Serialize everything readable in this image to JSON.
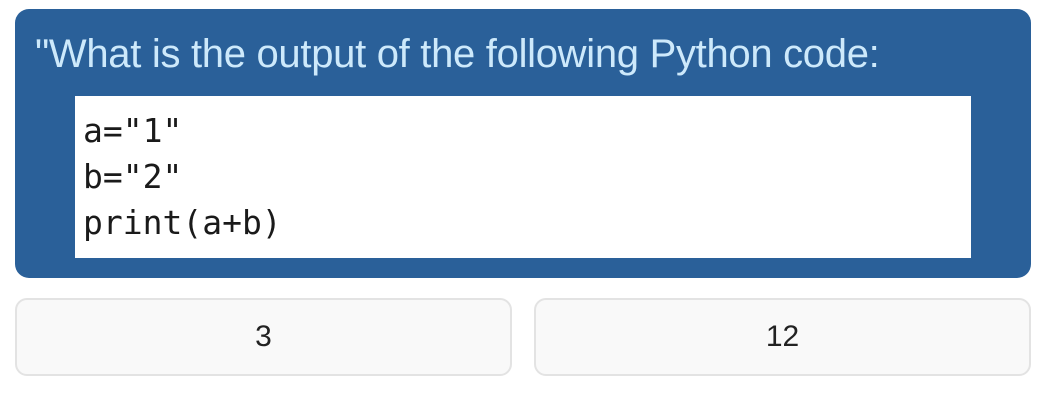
{
  "question": {
    "text": "\"What is the output of the following Python code:",
    "code_lines": [
      "a=\"1\"",
      "b=\"2\"",
      "print(a+b)"
    ]
  },
  "answers": [
    {
      "label": "3"
    },
    {
      "label": "12"
    }
  ],
  "colors": {
    "card_background": "#2a6099",
    "question_text": "#cde9fb",
    "code_background": "#ffffff",
    "button_background": "#f9f9f9",
    "button_border": "#e3e3e3"
  }
}
